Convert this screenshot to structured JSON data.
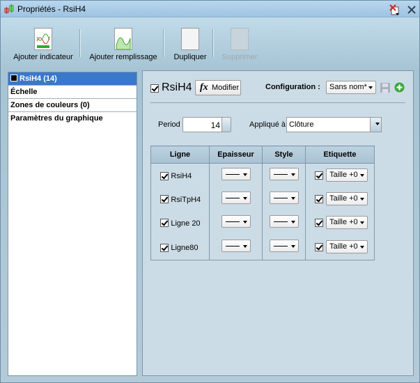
{
  "window": {
    "title": "Propriétés - RsiH4"
  },
  "toolbar": {
    "add_indicator": "Ajouter indicateur",
    "add_fill": "Ajouter remplissage",
    "duplicate": "Dupliquer",
    "delete": "Supprimer"
  },
  "sidebar": {
    "items": [
      {
        "label": "RsiH4 (14)"
      },
      {
        "label": "Échelle"
      },
      {
        "label": "Zones de couleurs (0)"
      },
      {
        "label": "Paramètres du graphique"
      }
    ]
  },
  "panel": {
    "indicator_name": "RsiH4",
    "modify_label": "Modifier",
    "fx": "fx",
    "config_label": "Configuration :",
    "config_value": "Sans nom*",
    "period_label": "Period",
    "period_value": "14",
    "applied_label": "Appliqué à",
    "applied_value": "Clôture"
  },
  "table": {
    "headers": [
      "Ligne",
      "Epaisseur",
      "Style",
      "Etiquette"
    ],
    "rows": [
      {
        "name": "RsiH4",
        "label": "Taille +0"
      },
      {
        "name": "RsiTpH4",
        "label": "Taille +0"
      },
      {
        "name": "Ligne 20",
        "label": "Taille +0"
      },
      {
        "name": "Ligne80",
        "label": "Taille +0"
      }
    ]
  }
}
